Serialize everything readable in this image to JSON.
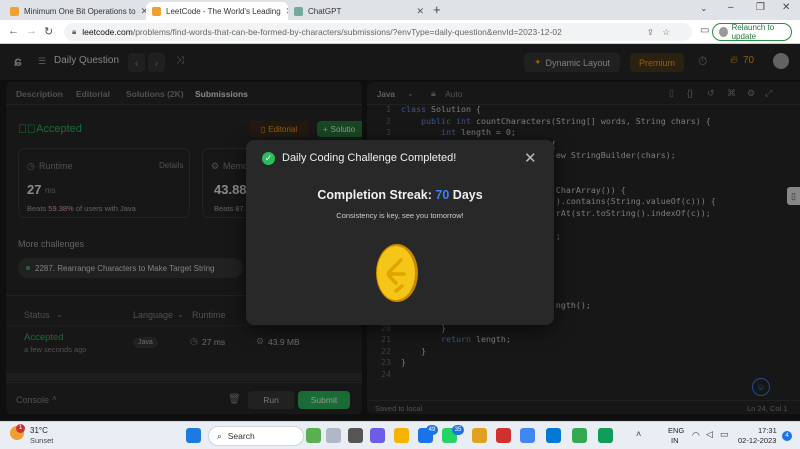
{
  "browser": {
    "tabs": [
      {
        "title": "Minimum One Bit Operations to"
      },
      {
        "title": "LeetCode - The World's Leading"
      },
      {
        "title": "ChatGPT"
      }
    ],
    "new_tab": "+",
    "url_host": "leetcode.com",
    "url_rest": "/problems/find-words-that-can-be-formed-by-characters/submissions/?envType=daily-question&envId=2023-12-02",
    "relaunch_label": "Relaunch to update"
  },
  "nav": {
    "title": "Daily Question",
    "dynamic_layout": "Dynamic Layout",
    "premium": "Premium",
    "streak_count": "70"
  },
  "left": {
    "tabs": [
      "Description",
      "Editorial",
      "Solutions (2K)",
      "Submissions"
    ],
    "accepted": "Accepted",
    "editorial_btn": "Editorial",
    "solution_btn": "Solutio",
    "runtime_label": "Runtime",
    "details": "Details",
    "runtime_value": "27",
    "runtime_unit": "ms",
    "beats_label": "Beats",
    "beats_value": "59.38%",
    "beats_suffix": "of users with Java",
    "memory_label": "Memo",
    "memory_value": "43.88",
    "memory_beats": "Beats 87.",
    "more_challenges": "More challenges",
    "challenge": "2287. Rearrange Characters to Make Target String",
    "col_status": "Status",
    "col_language": "Language",
    "col_runtime": "Runtime",
    "row_status": "Accepted",
    "row_time": "a few seconds ago",
    "row_lang": "Java",
    "row_runtime": "27 ms",
    "row_memory": "43.9 MB",
    "console": "Console",
    "run": "Run",
    "submit": "Submit"
  },
  "right": {
    "language": "Java",
    "mode": "Auto",
    "saved": "Saved to local",
    "position": "Ln 24, Col 1",
    "code": [
      {
        "n": "1",
        "t": "class Solution {"
      },
      {
        "n": "2",
        "t": "    public int countCharacters(String[] words, String chars) {"
      },
      {
        "n": "3",
        "t": "        int length = 0;"
      },
      {
        "n": "4",
        "t": "                              {"
      },
      {
        "n": "5",
        "t": "                               ew StringBuilder(chars);"
      },
      {
        "n": "6",
        "t": ""
      },
      {
        "n": "7",
        "t": ""
      },
      {
        "n": "8",
        "t": "                               CharArray()) {"
      },
      {
        "n": "9",
        "t": "                               ).contains(String.valueOf(c))) {"
      },
      {
        "n": "10",
        "t": "                               rAt(str.toString().indexOf(c));"
      },
      {
        "n": "11",
        "t": ""
      },
      {
        "n": "12",
        "t": "                               ;"
      },
      {
        "n": "13",
        "t": ""
      },
      {
        "n": "14",
        "t": ""
      },
      {
        "n": "15",
        "t": ""
      },
      {
        "n": "16",
        "t": ""
      },
      {
        "n": "17",
        "t": ""
      },
      {
        "n": "18",
        "t": "                               ngth();"
      },
      {
        "n": "19",
        "t": ""
      },
      {
        "n": "20",
        "t": "        }"
      },
      {
        "n": "21",
        "t": "        return length;"
      },
      {
        "n": "22",
        "t": "    }"
      },
      {
        "n": "23",
        "t": "}"
      },
      {
        "n": "24",
        "t": ""
      }
    ]
  },
  "modal": {
    "title": "Daily Coding Challenge Completed!",
    "streak_label": "Completion Streak:",
    "streak_value": "70",
    "streak_unit": "Days",
    "subtitle": "Consistency is key, see you tomorrow!"
  },
  "taskbar": {
    "weather_temp": "31°C",
    "weather_desc": "Sunset",
    "weather_badge": "1",
    "search": "Search",
    "badge_a": "49",
    "badge_b": "35",
    "lang_top": "ENG",
    "lang_bottom": "IN",
    "time": "17:31",
    "date": "02-12-2023",
    "notif": "4"
  },
  "colors": {
    "accent_green": "#2cbb5d",
    "accent_orange": "#ffa116",
    "streak_blue": "#3b82f6",
    "coin_gold": "#f5c518"
  }
}
